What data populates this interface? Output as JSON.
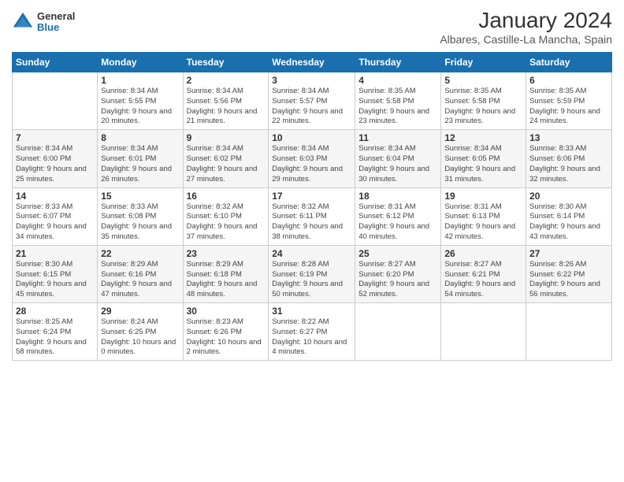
{
  "logo": {
    "general": "General",
    "blue": "Blue"
  },
  "title": "January 2024",
  "location": "Albares, Castille-La Mancha, Spain",
  "days_of_week": [
    "Sunday",
    "Monday",
    "Tuesday",
    "Wednesday",
    "Thursday",
    "Friday",
    "Saturday"
  ],
  "weeks": [
    [
      {
        "day": "",
        "sunrise": "",
        "sunset": "",
        "daylight": ""
      },
      {
        "day": "1",
        "sunrise": "Sunrise: 8:34 AM",
        "sunset": "Sunset: 5:55 PM",
        "daylight": "Daylight: 9 hours and 20 minutes."
      },
      {
        "day": "2",
        "sunrise": "Sunrise: 8:34 AM",
        "sunset": "Sunset: 5:56 PM",
        "daylight": "Daylight: 9 hours and 21 minutes."
      },
      {
        "day": "3",
        "sunrise": "Sunrise: 8:34 AM",
        "sunset": "Sunset: 5:57 PM",
        "daylight": "Daylight: 9 hours and 22 minutes."
      },
      {
        "day": "4",
        "sunrise": "Sunrise: 8:35 AM",
        "sunset": "Sunset: 5:58 PM",
        "daylight": "Daylight: 9 hours and 23 minutes."
      },
      {
        "day": "5",
        "sunrise": "Sunrise: 8:35 AM",
        "sunset": "Sunset: 5:58 PM",
        "daylight": "Daylight: 9 hours and 23 minutes."
      },
      {
        "day": "6",
        "sunrise": "Sunrise: 8:35 AM",
        "sunset": "Sunset: 5:59 PM",
        "daylight": "Daylight: 9 hours and 24 minutes."
      }
    ],
    [
      {
        "day": "7",
        "sunrise": "Sunrise: 8:34 AM",
        "sunset": "Sunset: 6:00 PM",
        "daylight": "Daylight: 9 hours and 25 minutes."
      },
      {
        "day": "8",
        "sunrise": "Sunrise: 8:34 AM",
        "sunset": "Sunset: 6:01 PM",
        "daylight": "Daylight: 9 hours and 26 minutes."
      },
      {
        "day": "9",
        "sunrise": "Sunrise: 8:34 AM",
        "sunset": "Sunset: 6:02 PM",
        "daylight": "Daylight: 9 hours and 27 minutes."
      },
      {
        "day": "10",
        "sunrise": "Sunrise: 8:34 AM",
        "sunset": "Sunset: 6:03 PM",
        "daylight": "Daylight: 9 hours and 29 minutes."
      },
      {
        "day": "11",
        "sunrise": "Sunrise: 8:34 AM",
        "sunset": "Sunset: 6:04 PM",
        "daylight": "Daylight: 9 hours and 30 minutes."
      },
      {
        "day": "12",
        "sunrise": "Sunrise: 8:34 AM",
        "sunset": "Sunset: 6:05 PM",
        "daylight": "Daylight: 9 hours and 31 minutes."
      },
      {
        "day": "13",
        "sunrise": "Sunrise: 8:33 AM",
        "sunset": "Sunset: 6:06 PM",
        "daylight": "Daylight: 9 hours and 32 minutes."
      }
    ],
    [
      {
        "day": "14",
        "sunrise": "Sunrise: 8:33 AM",
        "sunset": "Sunset: 6:07 PM",
        "daylight": "Daylight: 9 hours and 34 minutes."
      },
      {
        "day": "15",
        "sunrise": "Sunrise: 8:33 AM",
        "sunset": "Sunset: 6:08 PM",
        "daylight": "Daylight: 9 hours and 35 minutes."
      },
      {
        "day": "16",
        "sunrise": "Sunrise: 8:32 AM",
        "sunset": "Sunset: 6:10 PM",
        "daylight": "Daylight: 9 hours and 37 minutes."
      },
      {
        "day": "17",
        "sunrise": "Sunrise: 8:32 AM",
        "sunset": "Sunset: 6:11 PM",
        "daylight": "Daylight: 9 hours and 38 minutes."
      },
      {
        "day": "18",
        "sunrise": "Sunrise: 8:31 AM",
        "sunset": "Sunset: 6:12 PM",
        "daylight": "Daylight: 9 hours and 40 minutes."
      },
      {
        "day": "19",
        "sunrise": "Sunrise: 8:31 AM",
        "sunset": "Sunset: 6:13 PM",
        "daylight": "Daylight: 9 hours and 42 minutes."
      },
      {
        "day": "20",
        "sunrise": "Sunrise: 8:30 AM",
        "sunset": "Sunset: 6:14 PM",
        "daylight": "Daylight: 9 hours and 43 minutes."
      }
    ],
    [
      {
        "day": "21",
        "sunrise": "Sunrise: 8:30 AM",
        "sunset": "Sunset: 6:15 PM",
        "daylight": "Daylight: 9 hours and 45 minutes."
      },
      {
        "day": "22",
        "sunrise": "Sunrise: 8:29 AM",
        "sunset": "Sunset: 6:16 PM",
        "daylight": "Daylight: 9 hours and 47 minutes."
      },
      {
        "day": "23",
        "sunrise": "Sunrise: 8:29 AM",
        "sunset": "Sunset: 6:18 PM",
        "daylight": "Daylight: 9 hours and 48 minutes."
      },
      {
        "day": "24",
        "sunrise": "Sunrise: 8:28 AM",
        "sunset": "Sunset: 6:19 PM",
        "daylight": "Daylight: 9 hours and 50 minutes."
      },
      {
        "day": "25",
        "sunrise": "Sunrise: 8:27 AM",
        "sunset": "Sunset: 6:20 PM",
        "daylight": "Daylight: 9 hours and 52 minutes."
      },
      {
        "day": "26",
        "sunrise": "Sunrise: 8:27 AM",
        "sunset": "Sunset: 6:21 PM",
        "daylight": "Daylight: 9 hours and 54 minutes."
      },
      {
        "day": "27",
        "sunrise": "Sunrise: 8:26 AM",
        "sunset": "Sunset: 6:22 PM",
        "daylight": "Daylight: 9 hours and 56 minutes."
      }
    ],
    [
      {
        "day": "28",
        "sunrise": "Sunrise: 8:25 AM",
        "sunset": "Sunset: 6:24 PM",
        "daylight": "Daylight: 9 hours and 58 minutes."
      },
      {
        "day": "29",
        "sunrise": "Sunrise: 8:24 AM",
        "sunset": "Sunset: 6:25 PM",
        "daylight": "Daylight: 10 hours and 0 minutes."
      },
      {
        "day": "30",
        "sunrise": "Sunrise: 8:23 AM",
        "sunset": "Sunset: 6:26 PM",
        "daylight": "Daylight: 10 hours and 2 minutes."
      },
      {
        "day": "31",
        "sunrise": "Sunrise: 8:22 AM",
        "sunset": "Sunset: 6:27 PM",
        "daylight": "Daylight: 10 hours and 4 minutes."
      },
      {
        "day": "",
        "sunrise": "",
        "sunset": "",
        "daylight": ""
      },
      {
        "day": "",
        "sunrise": "",
        "sunset": "",
        "daylight": ""
      },
      {
        "day": "",
        "sunrise": "",
        "sunset": "",
        "daylight": ""
      }
    ]
  ]
}
